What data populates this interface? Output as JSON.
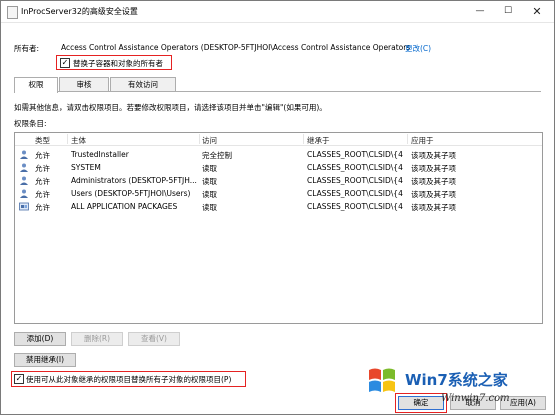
{
  "window": {
    "title": "InProcServer32的高级安全设置",
    "controls": {
      "minimize": "—",
      "maximize": "☐",
      "close": "✕"
    }
  },
  "owner": {
    "label": "所有者:",
    "value": "Access Control Assistance Operators (DESKTOP-5FTJHOI\\Access Control Assistance Operators",
    "change_link": "更改(C)",
    "replace_checkbox_label": "替换子容器和对象的所有者",
    "replace_checked": true
  },
  "tabs": [
    {
      "label": "权限",
      "active": true
    },
    {
      "label": "审核",
      "active": false
    },
    {
      "label": "有效访问",
      "active": false
    }
  ],
  "info_text": "如需其他信息，请双击权限项目。若要修改权限项目，请选择该项目并单击\"编辑\"(如果可用)。",
  "entries_label": "权限条目:",
  "columns": [
    "类型",
    "主体",
    "访问",
    "继承于",
    "应用于"
  ],
  "rows": [
    {
      "type": "允许",
      "principal": "TrustedInstaller",
      "access": "完全控制",
      "inherited": "CLASSES_ROOT\\CLSID\\{4...",
      "applies": "该项及其子项",
      "icon": "user-icon"
    },
    {
      "type": "允许",
      "principal": "SYSTEM",
      "access": "读取",
      "inherited": "CLASSES_ROOT\\CLSID\\{4...",
      "applies": "该项及其子项",
      "icon": "user-icon"
    },
    {
      "type": "允许",
      "principal": "Administrators (DESKTOP-5FTJH...",
      "access": "读取",
      "inherited": "CLASSES_ROOT\\CLSID\\{4...",
      "applies": "该项及其子项",
      "icon": "user-icon"
    },
    {
      "type": "允许",
      "principal": "Users (DESKTOP-5FTJHOI\\Users)",
      "access": "读取",
      "inherited": "CLASSES_ROOT\\CLSID\\{4...",
      "applies": "该项及其子项",
      "icon": "user-icon"
    },
    {
      "type": "允许",
      "principal": "ALL APPLICATION PACKAGES",
      "access": "读取",
      "inherited": "CLASSES_ROOT\\CLSID\\{4...",
      "applies": "该项及其子项",
      "icon": "package-icon"
    }
  ],
  "buttons": {
    "add": "添加(D)",
    "remove": "删除(R)",
    "view": "查看(V)",
    "disable_inheritance": "禁用继承(I)",
    "ok": "确定",
    "cancel": "取消",
    "apply": "应用(A)"
  },
  "replace_child_checkbox_label": "使用可从此对象继承的权限项目替换所有子对象的权限项目(P)",
  "replace_child_checked": true,
  "watermark": {
    "logo_text": "Win7系统之家",
    "url_text": "Winwin7.com"
  },
  "colors": {
    "highlight_box": "#e52222",
    "link": "#0066cc",
    "tab_border": "#adadad"
  }
}
